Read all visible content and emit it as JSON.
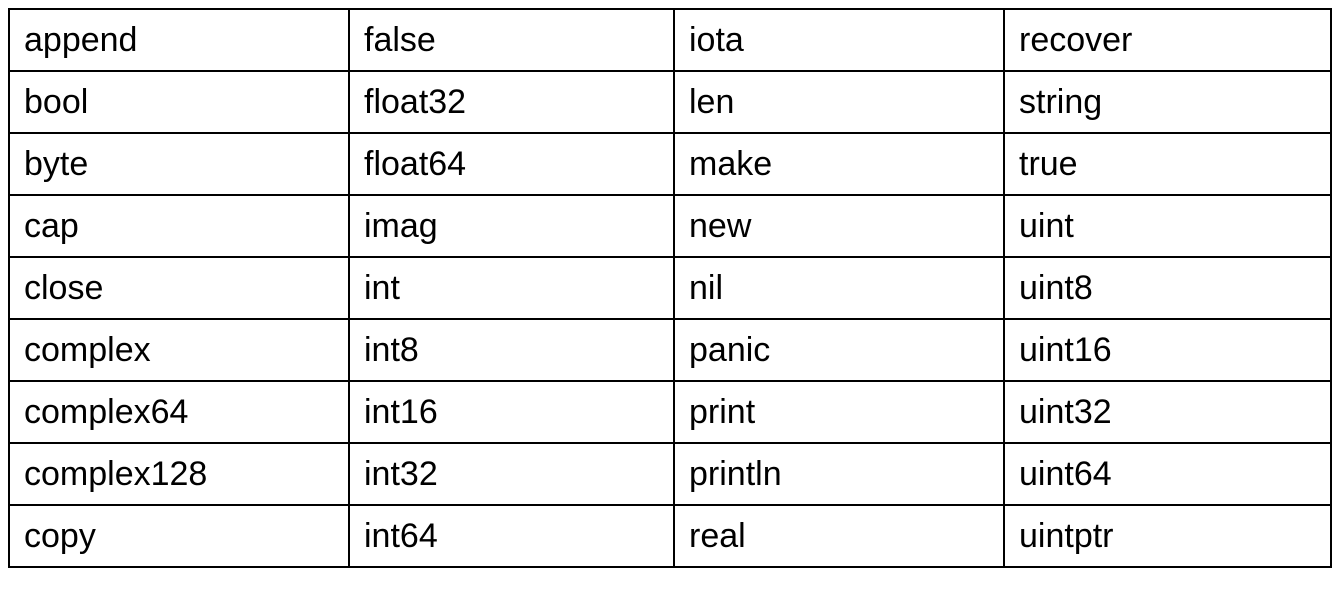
{
  "chart_data": {
    "type": "table",
    "columns": 4,
    "rows": 9,
    "cells": [
      [
        "append",
        "false",
        "iota",
        "recover"
      ],
      [
        "bool",
        "float32",
        "len",
        "string"
      ],
      [
        "byte",
        "float64",
        "make",
        "true"
      ],
      [
        "cap",
        "imag",
        "new",
        "uint"
      ],
      [
        "close",
        "int",
        "nil",
        "uint8"
      ],
      [
        "complex",
        "int8",
        "panic",
        "uint16"
      ],
      [
        "complex64",
        "int16",
        "print",
        "uint32"
      ],
      [
        "complex128",
        "int32",
        "println",
        "uint64"
      ],
      [
        "copy",
        "int64",
        "real",
        "uintptr"
      ]
    ]
  }
}
